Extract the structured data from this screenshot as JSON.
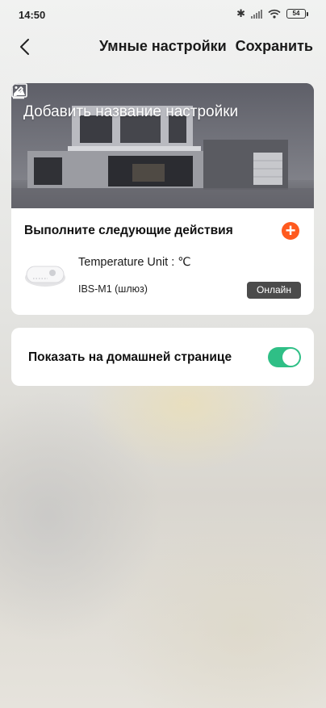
{
  "status_bar": {
    "time": "14:50",
    "battery_level": "54",
    "icons": [
      "bluetooth-icon",
      "signal-icon",
      "wifi-icon",
      "battery-icon"
    ]
  },
  "header": {
    "title": "Умные настройки",
    "save_label": "Сохранить",
    "back_icon": "chevron-left-icon"
  },
  "scene": {
    "name_placeholder": "Добавить название настройки",
    "edit_icon": "pencil-icon",
    "cover_icon": "image-icon"
  },
  "actions": {
    "title": "Выполните следующие действия",
    "add_icon": "plus-circle-icon",
    "add_symbol": "+",
    "items": [
      {
        "action": "Temperature Unit : ℃",
        "device": "IBS-M1 (шлюз)",
        "status": "Онлайн"
      }
    ]
  },
  "home_page": {
    "label": "Показать на домашней странице",
    "enabled": true
  },
  "colors": {
    "accent_add": "#ff5a1f",
    "toggle_on": "#2fbf86",
    "badge_bg": "#4b4b4b"
  }
}
